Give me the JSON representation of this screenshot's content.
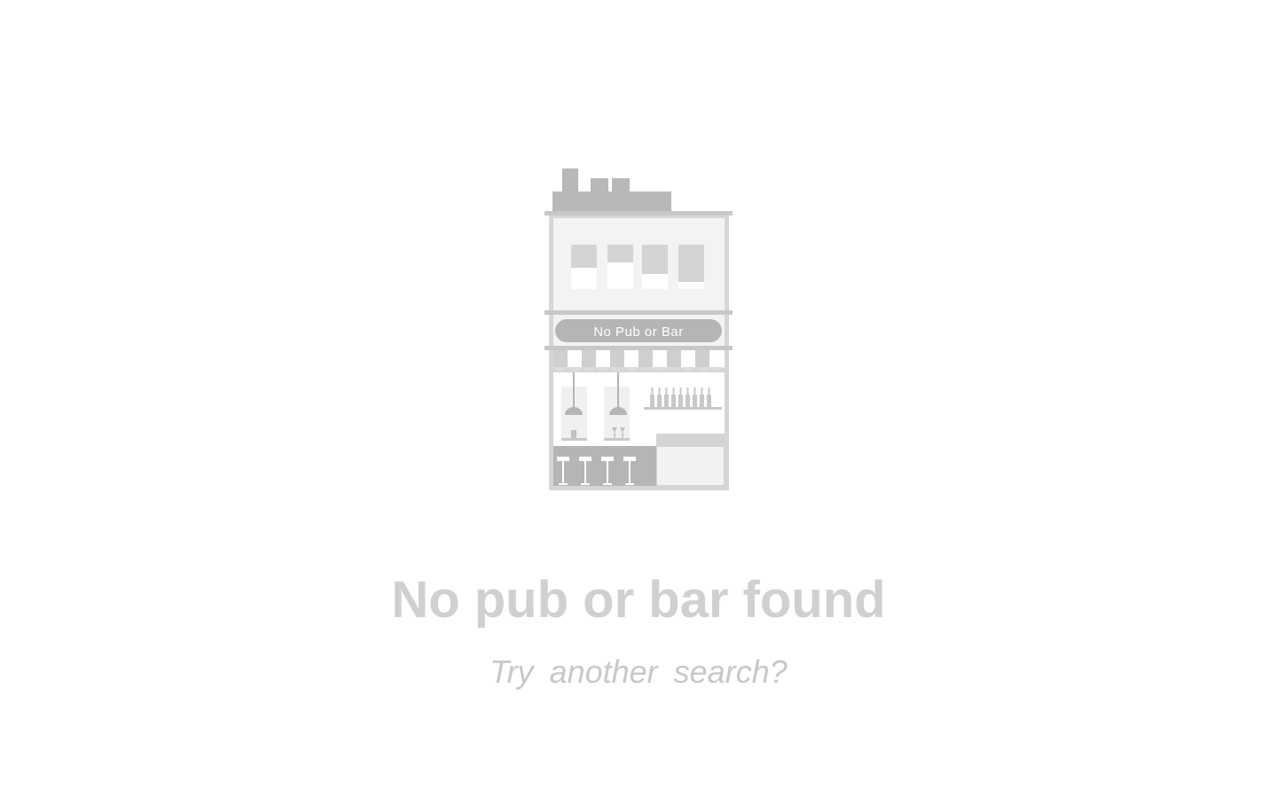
{
  "empty_state": {
    "sign_text": "No Pub or Bar",
    "title": "No pub or bar found",
    "subtitle": "Try another search?"
  },
  "colors": {
    "background": "#ffffff",
    "title": "#d0d0d0",
    "subtitle": "#c8c8c8",
    "illustration_dark": "#b5b5b5",
    "illustration_mid": "#d4d4d4",
    "illustration_light": "#f2f2f2"
  },
  "icons": {
    "illustration": "pub-building-illustration"
  }
}
